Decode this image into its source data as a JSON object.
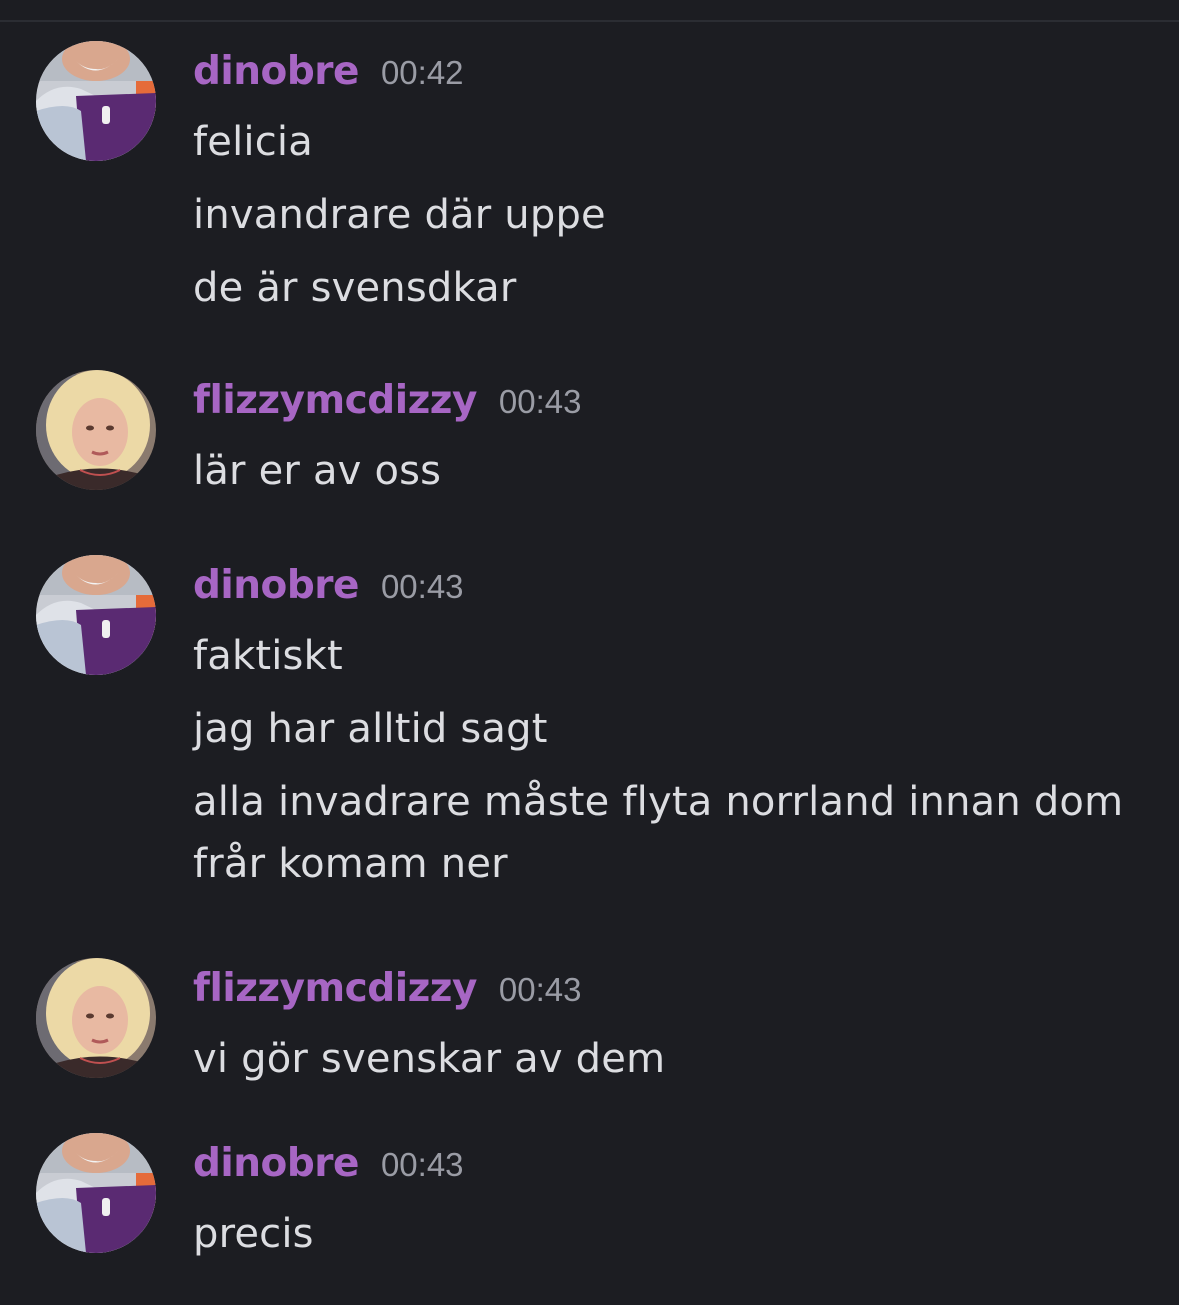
{
  "messages": [
    {
      "username": "dinobre",
      "time": "00:42",
      "avatar": "dinobre-avatar",
      "lines": [
        "felicia",
        "invandrare där uppe",
        "de är svensdkar"
      ]
    },
    {
      "username": "flizzymcdizzy",
      "time": "00:43",
      "avatar": "flizzymcdizzy-avatar",
      "lines": [
        "lär er av oss"
      ]
    },
    {
      "username": "dinobre",
      "time": "00:43",
      "avatar": "dinobre-avatar",
      "lines": [
        "faktiskt",
        "jag har alltid sagt",
        "alla invadrare måste flyta norrland innan dom frår komam ner"
      ]
    },
    {
      "username": "flizzymcdizzy",
      "time": "00:43",
      "avatar": "flizzymcdizzy-avatar",
      "lines": [
        "vi gör svenskar av dem"
      ]
    },
    {
      "username": "dinobre",
      "time": "00:43",
      "avatar": "dinobre-avatar",
      "lines": [
        "precis"
      ]
    }
  ],
  "colors": {
    "background": "#1c1d22",
    "username": "#a766c4",
    "timestamp": "#9a9ca5",
    "text": "#dcdde1"
  }
}
